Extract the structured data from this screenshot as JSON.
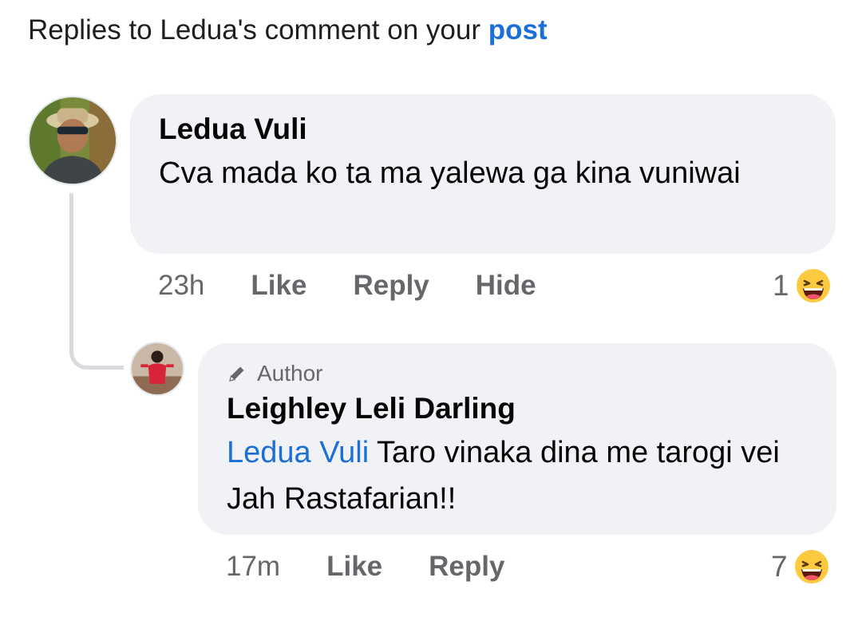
{
  "header": {
    "prefix": "Replies to Ledua's comment on your ",
    "link": "post"
  },
  "comment": {
    "author": "Ledua Vuli",
    "text": "Cva mada ko ta ma yalewa ga kina vuniwai",
    "time": "23h",
    "like": "Like",
    "reply": "Reply",
    "hide": "Hide",
    "reaction_count": "1",
    "reaction": "haha-emoji-icon"
  },
  "reply": {
    "badge": "Author",
    "author": "Leighley Leli Darling",
    "mention": "Ledua Vuli",
    "text": " Taro vinaka dina me tarogi vei Jah Rastafarian!!",
    "time": "17m",
    "like": "Like",
    "reply": "Reply",
    "reaction_count": "7",
    "reaction": "haha-emoji-icon"
  },
  "colors": {
    "link": "#1b6fd6",
    "bubble": "#f0f2f5",
    "muted": "#65676b",
    "text": "#050505"
  }
}
